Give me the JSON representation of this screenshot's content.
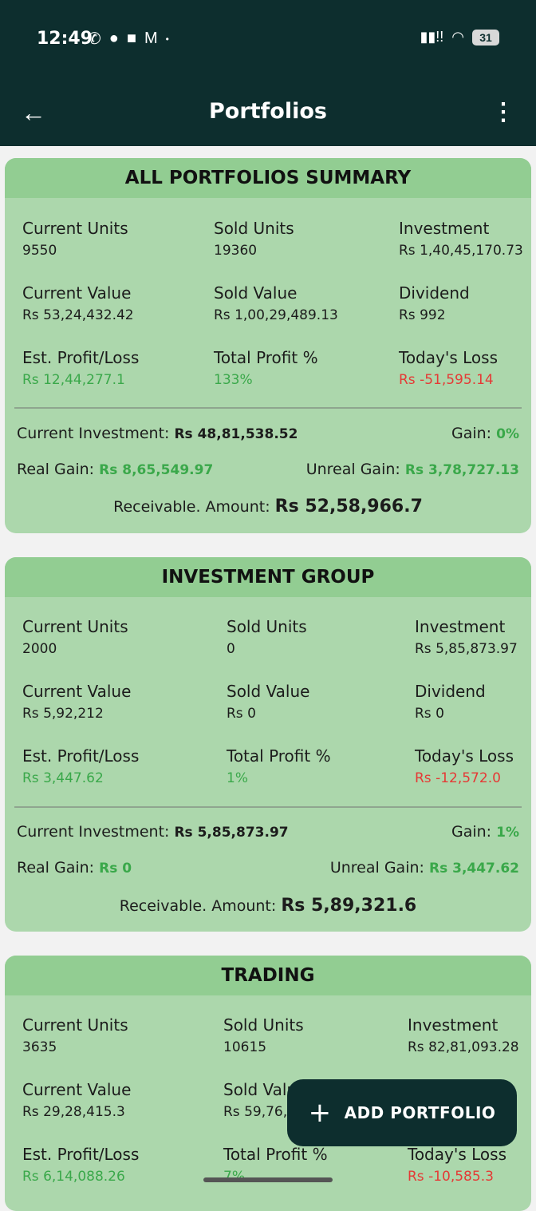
{
  "status_bar": {
    "time": "12:49",
    "battery": "31"
  },
  "appbar": {
    "title": "Portfolios"
  },
  "cards": [
    {
      "title": "ALL PORTFOLIOS SUMMARY",
      "current_units_label": "Current Units",
      "current_units": "9550",
      "sold_units_label": "Sold Units",
      "sold_units": "19360",
      "investment_label": "Investment",
      "investment": "Rs 1,40,45,170.73",
      "current_value_label": "Current Value",
      "current_value": "Rs 53,24,432.42",
      "sold_value_label": "Sold Value",
      "sold_value": "Rs 1,00,29,489.13",
      "dividend_label": "Dividend",
      "dividend": "Rs 992",
      "est_pl_label": "Est. Profit/Loss",
      "est_pl": "Rs 12,44,277.1",
      "total_profit_label": "Total Profit %",
      "total_profit": "133%",
      "today_label": "Today's Loss",
      "today": "Rs -51,595.14",
      "current_investment_label": "Current Investment:",
      "current_investment": "Rs 48,81,538.52",
      "gain_label": "Gain:",
      "gain": "0%",
      "real_gain_label": "Real Gain:",
      "real_gain": "Rs 8,65,549.97",
      "unreal_gain_label": "Unreal Gain:",
      "unreal_gain": "Rs 3,78,727.13",
      "receivable_label": "Receivable. Amount:",
      "receivable": "Rs 52,58,966.7"
    },
    {
      "title": "INVESTMENT GROUP",
      "current_units_label": "Current Units",
      "current_units": "2000",
      "sold_units_label": "Sold Units",
      "sold_units": "0",
      "investment_label": "Investment",
      "investment": "Rs 5,85,873.97",
      "current_value_label": "Current Value",
      "current_value": "Rs 5,92,212",
      "sold_value_label": "Sold Value",
      "sold_value": "Rs 0",
      "dividend_label": "Dividend",
      "dividend": "Rs 0",
      "est_pl_label": "Est. Profit/Loss",
      "est_pl": "Rs 3,447.62",
      "total_profit_label": "Total Profit %",
      "total_profit": "1%",
      "today_label": "Today's Loss",
      "today": "Rs -12,572.0",
      "current_investment_label": "Current Investment:",
      "current_investment": "Rs 5,85,873.97",
      "gain_label": "Gain:",
      "gain": "1%",
      "real_gain_label": "Real Gain:",
      "real_gain": "Rs 0",
      "unreal_gain_label": "Unreal Gain:",
      "unreal_gain": "Rs 3,447.62",
      "receivable_label": "Receivable. Amount:",
      "receivable": "Rs 5,89,321.6"
    },
    {
      "title": "TRADING",
      "current_units_label": "Current Units",
      "current_units": "3635",
      "sold_units_label": "Sold Units",
      "sold_units": "10615",
      "investment_label": "Investment",
      "investment": "Rs 82,81,093.28",
      "current_value_label": "Current Value",
      "current_value": "Rs 29,28,415.3",
      "sold_value_label": "Sold Value",
      "sold_value": "Rs 59,76,3",
      "est_pl_label": "Est. Profit/Loss",
      "est_pl": "Rs 6,14,088.26",
      "total_profit_label": "Total Profit %",
      "total_profit": "7%",
      "today_label": "Today's Loss",
      "today": "Rs -10,585.3"
    }
  ],
  "fab": {
    "label": "ADD PORTFOLIO"
  },
  "colors": {
    "header": "#0d2e2e",
    "card": "#acd7ac",
    "card_head": "#92cd92",
    "positive": "#3aa84a",
    "negative": "#e53935"
  }
}
